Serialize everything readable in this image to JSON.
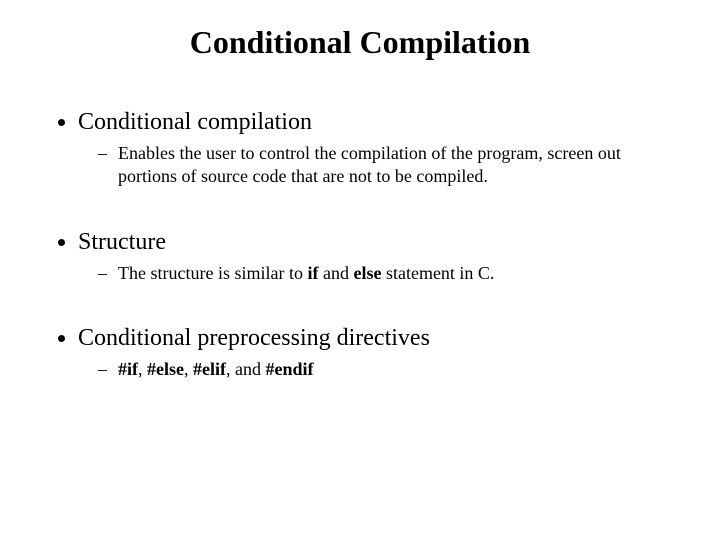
{
  "title": "Conditional Compilation",
  "items": [
    {
      "heading": "Conditional compilation",
      "sub": "Enables the user to control the compilation of the program, screen out portions of source code that are not to be compiled."
    },
    {
      "heading": "Structure",
      "sub_prefix": "The structure is similar to ",
      "sub_kw1": "if",
      "sub_mid": " and ",
      "sub_kw2": "else",
      "sub_suffix": " statement in C."
    },
    {
      "heading": "Conditional preprocessing directives",
      "dir1": "#if",
      "sep1": ", ",
      "dir2": "#else",
      "sep2": ", ",
      "dir3": "#elif",
      "sep3": ", and ",
      "dir4": "#endif"
    }
  ]
}
